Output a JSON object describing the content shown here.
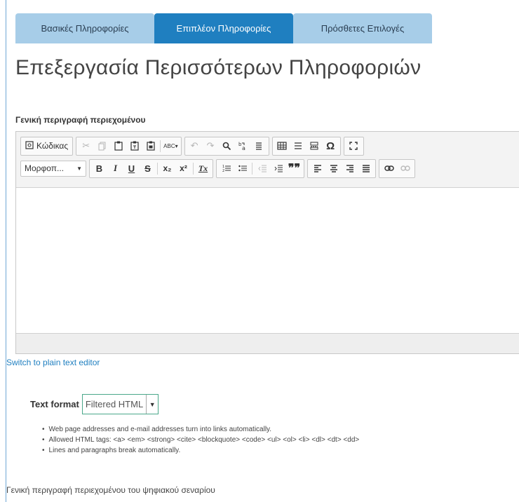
{
  "tabs": [
    {
      "label": "Βασικές Πληροφορίες",
      "active": false
    },
    {
      "label": "Επιπλέον Πληροφορίες",
      "active": true
    },
    {
      "label": "Πρόσθετες Επιλογές",
      "active": false
    }
  ],
  "page_title": "Επεξεργασία Περισσότερων Πληροφοριών",
  "section_label": "Γενική περιγραφή περιεχομένου",
  "editor": {
    "source_label": "Κώδικας",
    "format_combo": "Μορφοπ...",
    "toolbar": {
      "bold": "B",
      "italic": "I",
      "underline": "U",
      "strike": "S",
      "subscript": "x₂",
      "superscript": "x²",
      "remove_format": "Tx",
      "numbered_list": "1≡",
      "bulleted_list": "•≡",
      "outdent": "⇤",
      "indent": "⇥",
      "blockquote": "99",
      "special_char": "Ω",
      "spellcheck": "ABC"
    }
  },
  "switch_link": "Switch to plain text editor",
  "text_format": {
    "label": "Text format",
    "value": "Filtered HTML"
  },
  "tips": [
    "Web page addresses and e-mail addresses turn into links automatically.",
    "Allowed HTML tags: <a> <em> <strong> <cite> <blockquote> <code> <ul> <ol> <li> <dl> <dt> <dd>",
    "Lines and paragraphs break automatically."
  ],
  "bottom_label": "Γενική περιγραφή περιεχομένου του ψηφιακού σεναρίου",
  "colors": {
    "tab_active": "#1f7fc0",
    "tab_inactive": "#a7cde8",
    "link": "#1f7fc0",
    "select_border": "#4aa88a"
  }
}
